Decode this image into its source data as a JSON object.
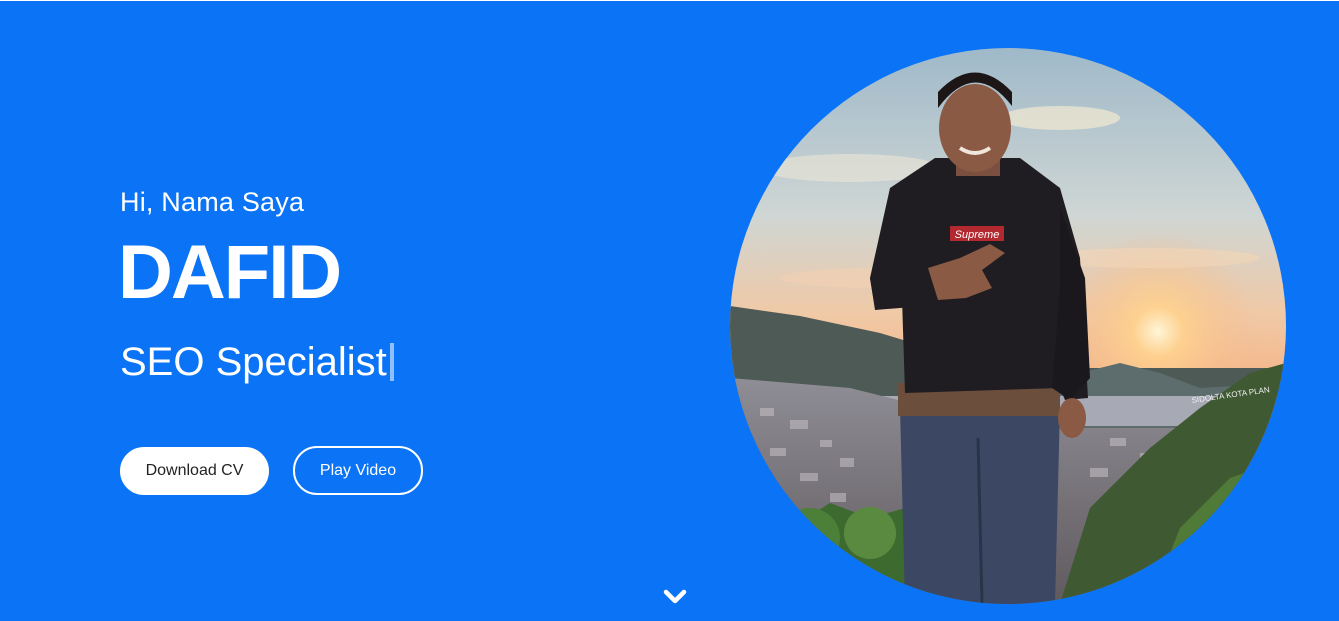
{
  "hero": {
    "greeting": "Hi, Nama Saya",
    "name": "DAFID",
    "role": "SEO Specialist",
    "background_color": "#0b73f6"
  },
  "buttons": {
    "download_label": "Download CV",
    "video_label": "Play Video"
  },
  "photo": {
    "alt": "Profile photo of Dafid at sunset over a hillside town",
    "shirt_logo": "Supreme",
    "sign_text": "SIDOLTA KOTA PLAN"
  },
  "icons": {
    "scroll": "chevron-down-icon"
  }
}
